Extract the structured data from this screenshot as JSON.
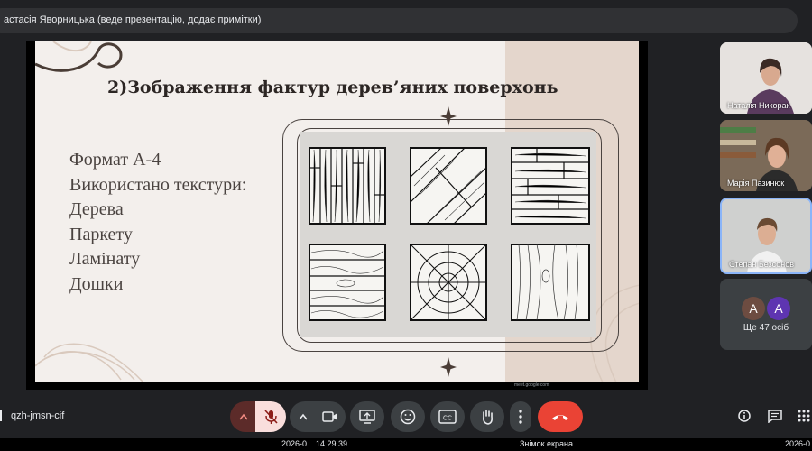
{
  "header": {
    "presenter_status": "астасія Яворницька (веде презентацію, додає примітки)"
  },
  "slide": {
    "title": "2)Зображення фактур дерев’яних поверхонь",
    "lines": [
      "Формат А-4",
      "Використано текстури:",
      "Дерева",
      "Паркету",
      "Ламінату",
      "Дошки"
    ]
  },
  "participants": [
    {
      "name": "Наталія Никорак"
    },
    {
      "name": "Марія Пазинюк"
    },
    {
      "name": "Степан Безсонов"
    }
  ],
  "more_participants": {
    "avatars": [
      "А",
      "А"
    ],
    "avatar_colors": [
      "#6d4c41",
      "#5e35b1"
    ],
    "label": "Ще 47 осіб"
  },
  "controls": {
    "meeting_code": "qzh-jmsn-cif",
    "captions_icon_text": "CC"
  },
  "watermark": "meet.google.com",
  "taskbar": {
    "time": "2026-0... 14.29.39",
    "screenshot_label": "Знімок екрана",
    "right_time": "2026-0"
  },
  "colors": {
    "end_call": "#ea4335",
    "mic_off": "#f28b82",
    "accent_tile": "#8ab4f8"
  }
}
